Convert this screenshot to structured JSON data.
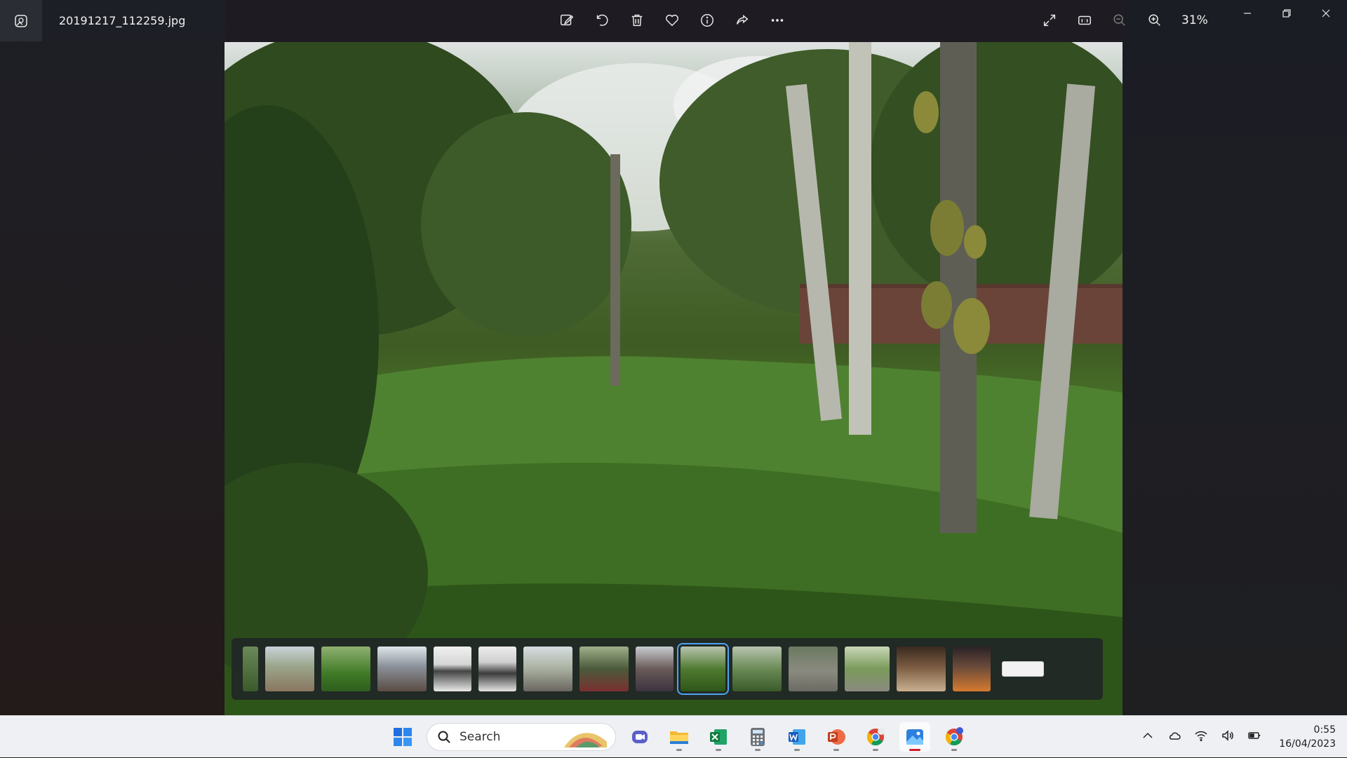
{
  "window": {
    "file_name": "20191217_112259.jpg",
    "zoom": "31%"
  },
  "toolbar": {
    "items": [
      "edit-image-icon",
      "rotate-icon",
      "delete-icon",
      "favorite-icon",
      "info-icon",
      "share-icon",
      "more-options-icon"
    ]
  },
  "right_tools": {
    "items": [
      "fullscreen-icon",
      "actual-size-icon",
      "zoom-out-icon",
      "zoom-in-icon"
    ]
  },
  "filmstrip": {
    "thumbnail_count": 16,
    "selected_index": 9,
    "accent": "#4ea3f2"
  },
  "taskbar": {
    "search_label": "Search",
    "pinned": [
      "start-icon",
      "meet-icon",
      "file-explorer-icon",
      "excel-icon",
      "calculator-icon",
      "word-icon",
      "powerpoint-icon",
      "chrome-icon",
      "photos-icon",
      "chrome-profile-icon"
    ],
    "active_app": "photos-icon"
  },
  "tray": {
    "time": "0:55",
    "date": "16/04/2023"
  }
}
